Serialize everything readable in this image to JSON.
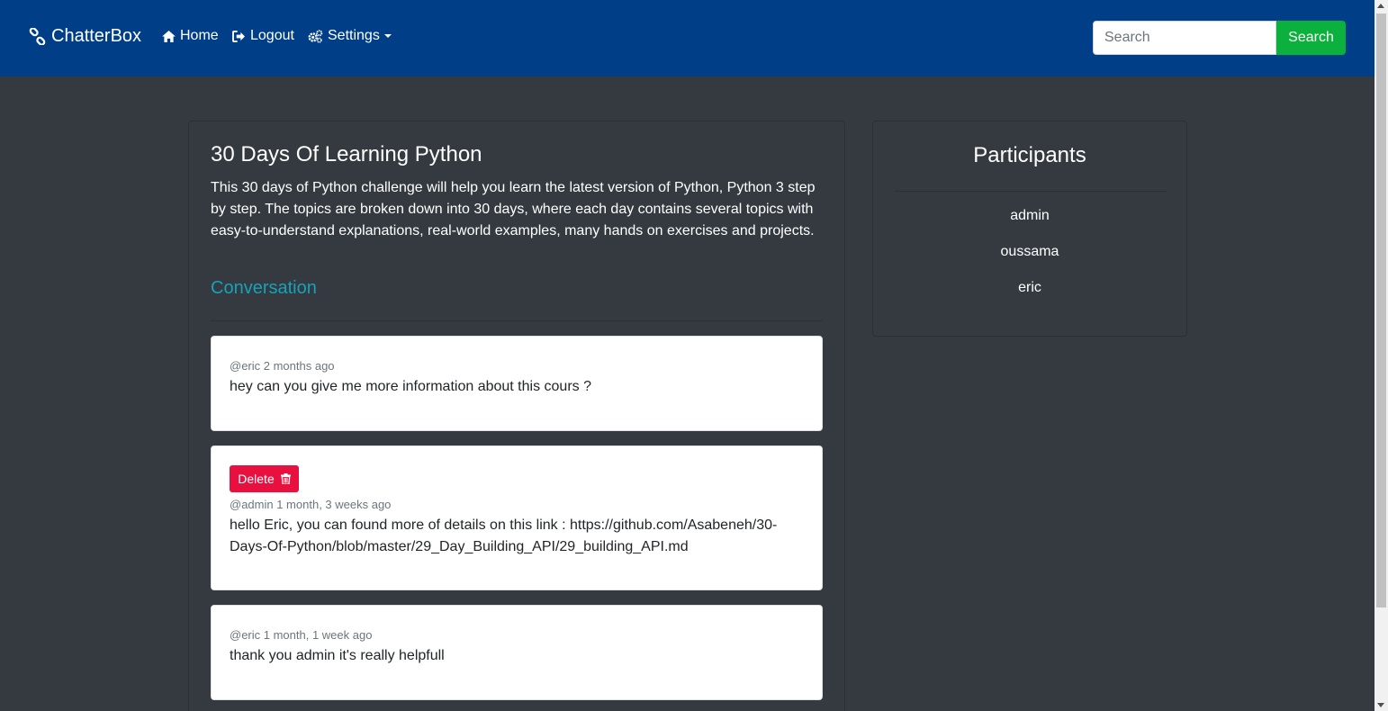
{
  "navbar": {
    "brand": "ChatterBox",
    "links": {
      "home": "Home",
      "logout": "Logout",
      "settings": "Settings"
    },
    "search": {
      "placeholder": "Search",
      "button": "Search"
    }
  },
  "room": {
    "title": "30 Days Of Learning Python",
    "description": "This 30 days of Python challenge will help you learn the latest version of Python, Python 3 step by step. The topics are broken down into 30 days, where each day contains several topics with easy-to-understand explanations, real-world examples, many hands on exercises and projects.",
    "conversation_title": "Conversation",
    "messages": [
      {
        "meta": "@eric 2 months ago",
        "body": "hey can you give me more information about this cours ?"
      },
      {
        "delete_label": "Delete",
        "meta": "@admin 1 month, 3 weeks ago",
        "body": "hello Eric, you can found more of details on this link : https://github.com/Asabeneh/30-Days-Of-Python/blob/master/29_Day_Building_API/29_building_API.md"
      },
      {
        "meta": "@eric 1 month, 1 week ago",
        "body": "thank you admin it's really helpfull"
      }
    ]
  },
  "participants": {
    "title": "Participants",
    "users": [
      "admin",
      "oussama",
      "eric"
    ]
  },
  "colors": {
    "navbar_bg": "#003f88",
    "page_bg": "#343a40",
    "search_button": "#0cb03c",
    "conversation_accent": "#17a2b8",
    "delete_button": "#e8103f"
  }
}
